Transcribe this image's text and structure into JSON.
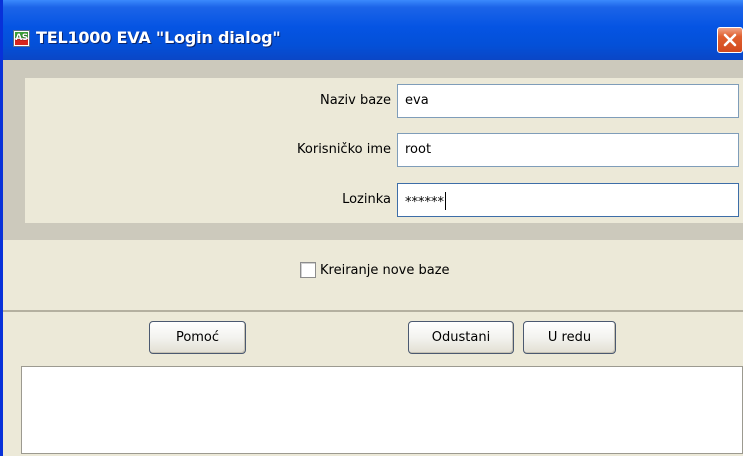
{
  "window": {
    "title": "TEL1000 EVA \"Login dialog\"",
    "icon": "app-logo-icon",
    "icon_text": "AS",
    "close_icon": "close-icon"
  },
  "form": {
    "fields": [
      {
        "label": "Naziv baze",
        "value": "eva"
      },
      {
        "label": "Korisničko ime",
        "value": "root"
      },
      {
        "label": "Lozinka",
        "value": "******"
      }
    ]
  },
  "options": {
    "create_new_db_label": "Kreiranje nove baze",
    "create_new_db_checked": false
  },
  "buttons": {
    "help": "Pomoć",
    "cancel": "Odustani",
    "ok": "U redu"
  },
  "colors": {
    "titlebar": "#0554e3",
    "close_button": "#d24a1e",
    "dialog_background": "#ece9d8",
    "band": "#ccc9bc"
  }
}
